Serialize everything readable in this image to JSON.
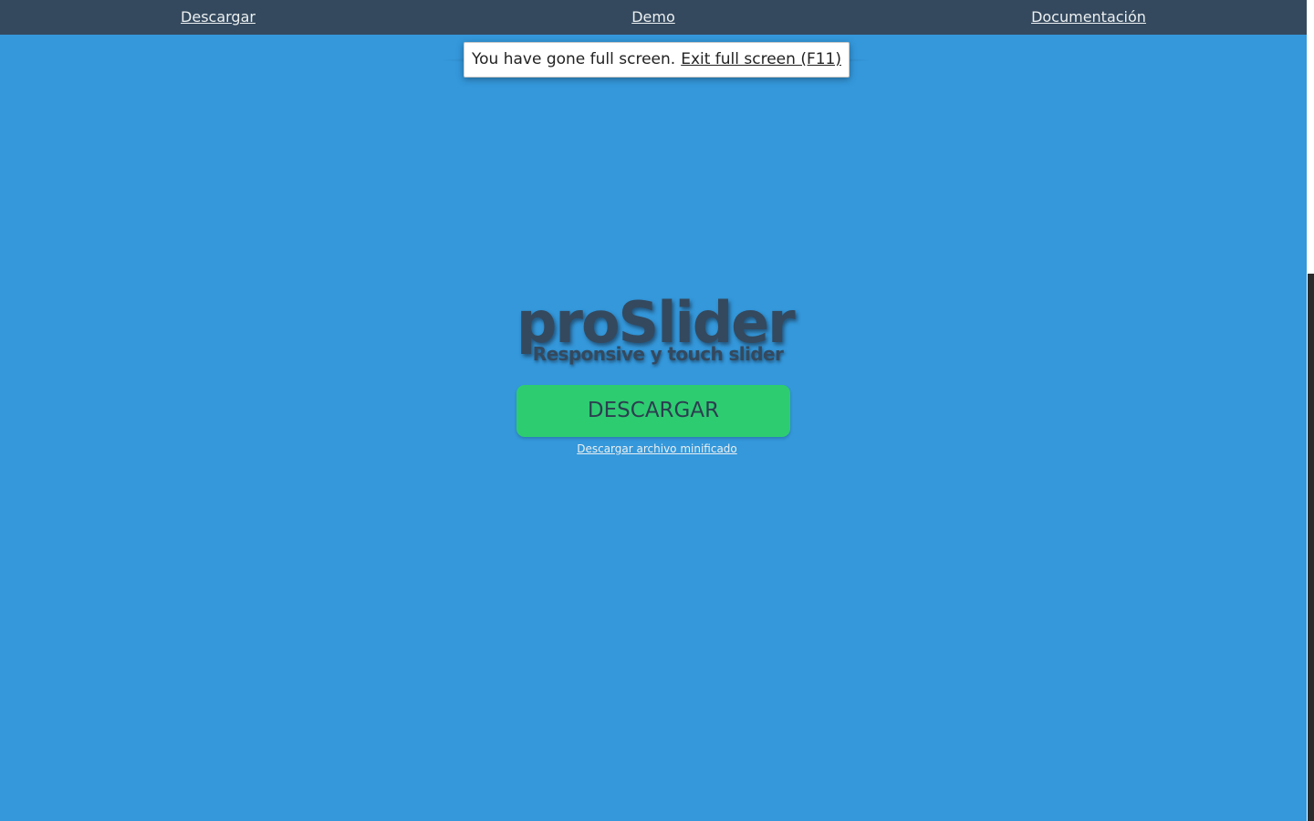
{
  "nav": {
    "items": [
      {
        "label": "Descargar"
      },
      {
        "label": "Demo"
      },
      {
        "label": "Documentación"
      }
    ]
  },
  "fullscreen_notice": {
    "message": "You have gone full screen.",
    "exit_label": "Exit full screen (F11)"
  },
  "logo": {
    "title": "proSlider",
    "subtitle": "Responsive y touch slider"
  },
  "main": {
    "download_button": "DESCARGAR",
    "minified_link": "Descargar archivo minificado"
  },
  "colors": {
    "background": "#3498db",
    "nav_background": "#34495e",
    "button": "#2ecc71",
    "logo_text": "#34495e"
  }
}
